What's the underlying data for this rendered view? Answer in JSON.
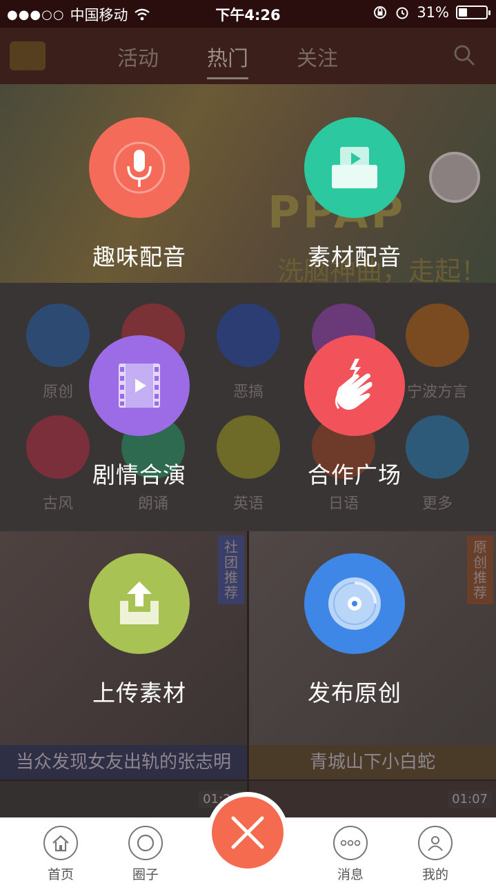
{
  "status_bar": {
    "signal": "●●●○○",
    "carrier": "中国移动",
    "time": "下午4:26",
    "battery": "31%",
    "battery_level": 0.31
  },
  "top_nav": {
    "tabs": [
      {
        "label": "活动"
      },
      {
        "label": "热门"
      },
      {
        "label": "关注"
      }
    ],
    "active_tab": "热门"
  },
  "banner": {
    "title": "PPAP",
    "subtitle": "洗脑神曲，走起！"
  },
  "categories": [
    {
      "label": "原创",
      "color": "#2d4a73"
    },
    {
      "label": "",
      "color": "#7a3236"
    },
    {
      "label": "恶搞",
      "color": "#2c3d73"
    },
    {
      "label": "",
      "color": "#6a3a78"
    },
    {
      "label": "宁波方言",
      "color": "#7a4a20"
    },
    {
      "label": "古风",
      "color": "#7a2f3a"
    },
    {
      "label": "朗诵",
      "color": "#2d6a4f"
    },
    {
      "label": "英语",
      "color": "#6e6a28"
    },
    {
      "label": "日语",
      "color": "#6e3a2a"
    },
    {
      "label": "更多",
      "color": "#2c5a78"
    }
  ],
  "feed": {
    "cards": [
      {
        "caption": "当众发现女友出轨的张志明",
        "tag": "社团推荐",
        "tag_color": "#3a3f6a"
      },
      {
        "caption": "青城山下小白蛇",
        "tag": "原创推荐",
        "tag_color": "#6a3f2a"
      }
    ],
    "durations": [
      "01:26",
      "01:07"
    ]
  },
  "actions": [
    {
      "label": "趣味配音",
      "color": "#f56b5a",
      "icon": "microphone-icon"
    },
    {
      "label": "素材配音",
      "color": "#2cc9a1",
      "icon": "video-material-icon"
    },
    {
      "label": "剧情合演",
      "color": "#9b6ce6",
      "icon": "film-strip-icon"
    },
    {
      "label": "合作广场",
      "color": "#f2525a",
      "icon": "hands-clap-icon"
    },
    {
      "label": "上传素材",
      "color": "#a8c254",
      "icon": "upload-tray-icon"
    },
    {
      "label": "发布原创",
      "color": "#3f87e6",
      "icon": "disc-icon"
    }
  ],
  "bottom_bar": {
    "items": [
      {
        "label": "首页",
        "icon": "home-icon"
      },
      {
        "label": "圈子",
        "icon": "circle-icon"
      },
      {
        "label": "消息",
        "icon": "message-icon"
      },
      {
        "label": "我的",
        "icon": "profile-icon"
      }
    ],
    "center_icon": "close-icon"
  }
}
